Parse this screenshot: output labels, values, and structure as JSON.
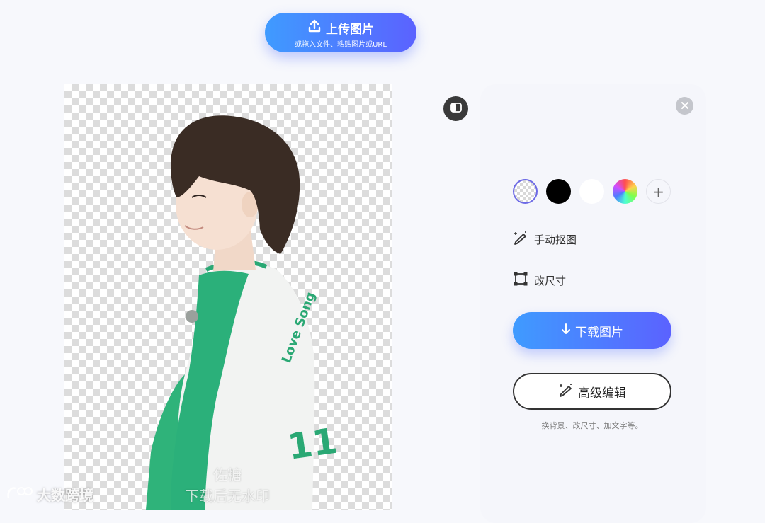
{
  "upload": {
    "label": "上传图片",
    "subtext": "或拖入文件、粘贴图片或URL",
    "icon": "upload-icon"
  },
  "canvas": {
    "watermark_line1": "佐糖",
    "watermark_line2": "下载后无水印",
    "brand_text": "大数跨境",
    "jersey_text": "Love Song",
    "jersey_number": "11"
  },
  "panel": {
    "backgrounds": [
      "transparent",
      "#000000",
      "#ffffff",
      "rainbow-gradient",
      "add"
    ],
    "manual_cutout_label": "手动抠图",
    "resize_label": "改尺寸",
    "download_label": "下载图片",
    "advanced_label": "高级编辑",
    "hint": "换背景、改尺寸、加文字等。"
  },
  "colors": {
    "accent_start": "#3f9bff",
    "accent_end": "#5b62ff",
    "page_bg": "#f7f8fc"
  }
}
